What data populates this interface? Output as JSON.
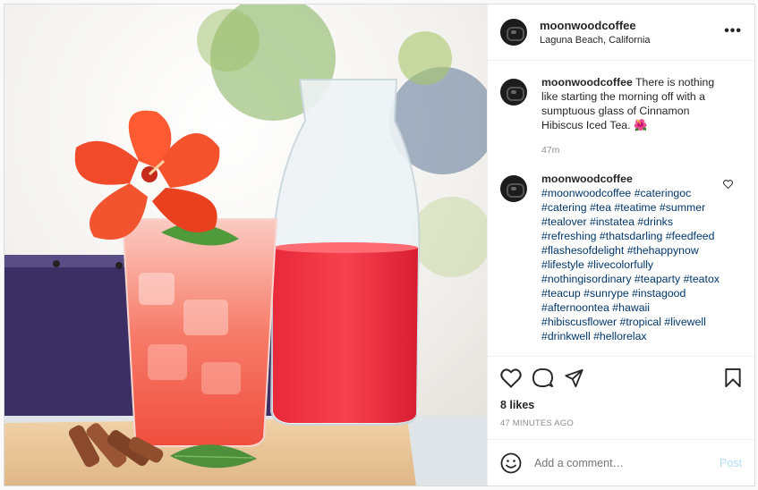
{
  "header": {
    "username": "moonwoodcoffee",
    "location": "Laguna Beach, California"
  },
  "caption": {
    "username": "moonwoodcoffee",
    "text": "There is nothing like starting the morning off with a sumptuous glass of Cinnamon Hibiscus Iced Tea. 🌺",
    "time": "47m"
  },
  "comment": {
    "username": "moonwoodcoffee",
    "text": "#moonwoodcoffee #cateringoc #catering #tea #teatime #summer #tealover #instatea #drinks #refreshing #thatsdarling #feedfeed #flashesofdelight #thehappynow #lifestyle #livecolorfully #nothingisordinary #teaparty #teatox #teacup #sunrype #instagood #afternoontea #hawaii #hibiscusflower #tropical #livewell #drinkwell #hellorelax"
  },
  "likes": "8 likes",
  "post_time": "47 MINUTES AGO",
  "add_comment": {
    "placeholder": "Add a comment…",
    "post_label": "Post"
  },
  "icons": {
    "more": "more-options-icon",
    "like": "heart-icon",
    "comment": "comment-bubble-icon",
    "share": "paper-plane-icon",
    "save": "bookmark-icon",
    "emoji": "smiley-icon"
  },
  "colors": {
    "link": "#00376b",
    "post_button": "#b2dffc",
    "muted": "#8e8e8e"
  }
}
